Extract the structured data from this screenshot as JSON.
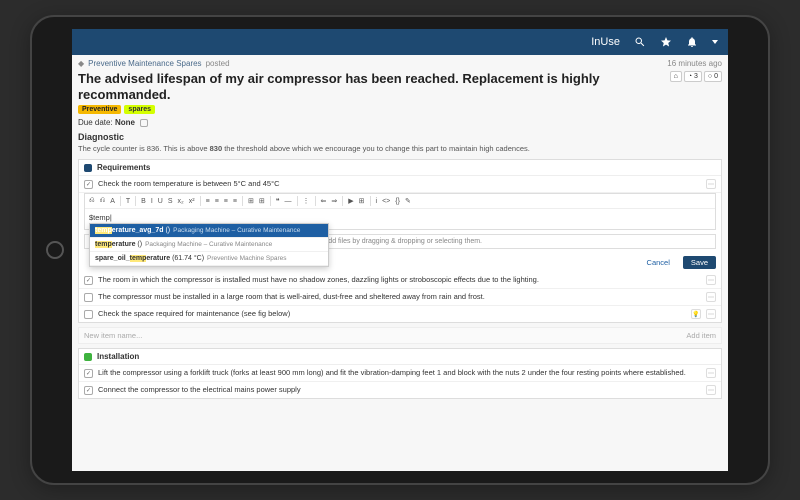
{
  "appbar": {
    "brand": "InUse"
  },
  "crumb": {
    "category": "Preventive Maintenance Spares",
    "suffix": "posted",
    "timestamp": "16 minutes ago"
  },
  "title": "The advised lifespan of my air compressor has been reached. Replacement is highly recommanded.",
  "actions": {
    "a1": "⌂",
    "a2": "◔ 3",
    "a3": "○ 0"
  },
  "tags": {
    "preventive": "Preventive",
    "spares": "spares"
  },
  "due": {
    "label": "Due date:",
    "value": "None"
  },
  "diagnostic": {
    "heading": "Diagnostic",
    "body_pre": "The cycle counter is 836. This is above ",
    "body_bold": "830",
    "body_post": " the threshold above which we encourage you to change this part to maintain high cadences."
  },
  "requirements": {
    "heading": "Requirements",
    "items": [
      "Check the room temperature is between 5°C and 45°C",
      "The room in which the compressor is installed must have no shadow zones, dazzling lights or stroboscopic effects due to the lighting.",
      "The compressor must be installed in a large room that is well-aired, dust-free and sheltered away from rain and frost.",
      "Check the space required for maintenance (see fig below)"
    ]
  },
  "editor": {
    "typed": "$temp",
    "toolbar": [
      "⎌",
      "⎌",
      "A",
      "",
      "T",
      "",
      "B",
      "I",
      "U",
      "S",
      "x₂",
      "x²",
      "",
      "≡",
      "≡",
      "≡",
      "≡",
      "",
      "⊞",
      "⊞",
      "",
      "❝",
      "—",
      "",
      "⋮",
      "",
      "⇐",
      "⇒",
      "",
      "▶",
      "⊞",
      "",
      "i",
      "<>",
      "{}",
      "✎"
    ],
    "dropdown": [
      {
        "name": "temperature_avg_7d",
        "val": "()",
        "ctx": "Packaging Machine – Curative Maintenance"
      },
      {
        "name": "temperature",
        "val": "()",
        "ctx": "Packaging Machine – Curative Maintenance"
      },
      {
        "name": "spare_oil_temperature",
        "val": "(61.74 °C)",
        "ctx": "Preventive Machine Spares"
      }
    ],
    "dropzone": "+ Add files by dragging & dropping or selecting them.",
    "cancel": "Cancel",
    "save": "Save"
  },
  "newitem": {
    "placeholder": "New item name...",
    "action": "Add item"
  },
  "installation": {
    "heading": "Installation",
    "items": [
      "Lift the compressor using a forklift truck (forks at least 900 mm long) and fit the vibration-damping feet 1 and block with the nuts 2 under the four resting points where established.",
      "Connect the compressor to the electrical mains power supply"
    ]
  }
}
